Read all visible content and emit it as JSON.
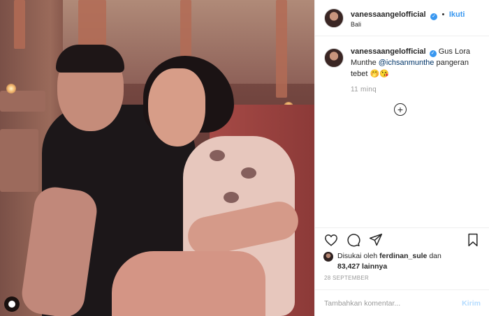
{
  "post": {
    "username": "vanessaangelofficial",
    "follow_label": "Ikuti",
    "separator": "•",
    "location": "Bali"
  },
  "caption": {
    "username": "vanessaangelofficial",
    "text_part1": "Gus Lora Munthe ",
    "mention": "@ichsanmunthe",
    "text_part2": " pangeran tebet 🤭😘",
    "time": "11 minq",
    "more_comments_symbol": "+"
  },
  "likes": {
    "prefix": "Disukai oleh ",
    "liker": "ferdinan_sule",
    "connector": " dan",
    "count": "83,427 lainnya"
  },
  "date": "28 SEPTEMBER",
  "comment_box": {
    "placeholder": "Tambahkan komentar...",
    "post_label": "Kirim"
  },
  "colors": {
    "accent": "#3897f0",
    "text": "#262626",
    "muted": "#999999",
    "border": "#efefef"
  },
  "icons": [
    "heart-icon",
    "comment-icon",
    "share-icon",
    "bookmark-icon",
    "verified-badge-icon",
    "add-comment-icon",
    "tag-user-icon"
  ]
}
